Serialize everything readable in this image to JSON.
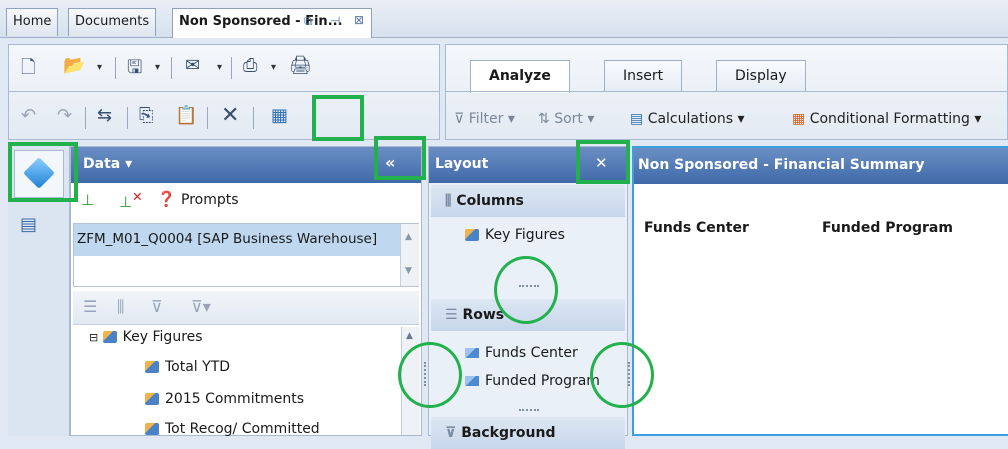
{
  "tabs": [
    {
      "label": "Home"
    },
    {
      "label": "Documents"
    },
    {
      "label": "Non Sponsored - Fin..."
    }
  ],
  "ribbon": {
    "tabs": [
      "Analyze",
      "Insert",
      "Display"
    ],
    "active_tab": "Analyze",
    "items": {
      "filter": "Filter",
      "sort": "Sort",
      "calculations": "Calculations",
      "conditional_formatting": "Conditional Formatting"
    }
  },
  "data_panel": {
    "title": "Data",
    "prompts": "Prompts",
    "source": "ZFM_M01_Q0004 [SAP Business Warehouse]",
    "tree": {
      "root": "Key Figures",
      "items": [
        "Total YTD",
        "2015 Commitments",
        "Tot Recog/ Committed"
      ]
    }
  },
  "layout_panel": {
    "title": "Layout",
    "columns_label": "Columns",
    "columns_items": [
      "Key Figures"
    ],
    "rows_label": "Rows",
    "rows_items": [
      "Funds Center",
      "Funded Program"
    ],
    "background_label": "Background"
  },
  "report": {
    "title": "Non Sponsored - Financial Summary",
    "columns": [
      "Funds Center",
      "Funded Program"
    ]
  },
  "colors": {
    "panel_header": "#4f78b5",
    "highlight": "#22b14c",
    "selection": "#bfd8f0",
    "report_border": "#3aa0e0"
  }
}
